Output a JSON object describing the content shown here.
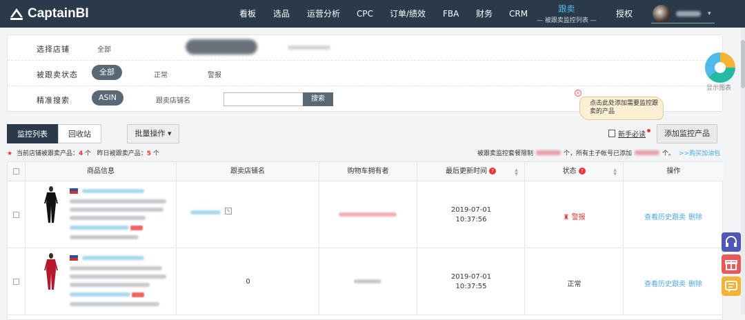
{
  "brand": {
    "name": "CaptainBI"
  },
  "nav": {
    "items": [
      "看板",
      "选品",
      "运营分析",
      "CPC",
      "订单/绩效",
      "FBA",
      "财务",
      "CRM"
    ],
    "active": {
      "label": "跟卖",
      "sub": "— 被跟卖监控列表 —"
    },
    "auth": "授权"
  },
  "filters": {
    "store": {
      "label": "选择店铺",
      "all": "全部"
    },
    "status": {
      "label": "被跟卖状态",
      "options": [
        "全部",
        "正常",
        "警报"
      ]
    },
    "search": {
      "label": "精准搜索",
      "type": "ASIN",
      "field_label": "跟卖店铺名",
      "value": "",
      "button": "搜索"
    }
  },
  "chart_toggle": {
    "label": "显示图表"
  },
  "tooltip": {
    "close": "×",
    "text": "点击此处添加需要监控跟卖的产品"
  },
  "tabs": [
    "监控列表",
    "回收站"
  ],
  "batch": {
    "label": "批量操作 ▾"
  },
  "guide": {
    "label": "新手必读"
  },
  "add_button": {
    "label": "添加监控产品"
  },
  "stats": {
    "current_label": "当前店铺被跟卖产品：",
    "current_count": "4",
    "current_unit": "个",
    "yesterday_label": "昨日被跟卖产品：",
    "yesterday_count": "5",
    "yesterday_unit": "个"
  },
  "limit": {
    "prefix": "被跟卖监控套餐限制",
    "mid": "个，所有主子帐号已添加",
    "suffix": "个。",
    "buy": ">>购买加油包"
  },
  "table": {
    "headers": [
      "商品信息",
      "跟卖店铺名",
      "购物车拥有者",
      "最后更新时间",
      "状态",
      "操作"
    ],
    "rows": [
      {
        "seller": "",
        "time_date": "2019-07-01",
        "time_clock": "10:37:56",
        "status": "警报",
        "action_history": "查看历史跟卖",
        "action_delete": "删除"
      },
      {
        "seller": "0",
        "time_date": "2019-07-01",
        "time_clock": "10:37:55",
        "status": "正常",
        "action_history": "查看历史跟卖",
        "action_delete": "删除"
      }
    ]
  },
  "colors": {
    "nav_bg": "#2a3a4a",
    "accent": "#4fc3e8",
    "alarm": "#dd3333",
    "link": "#4aa9e0"
  }
}
